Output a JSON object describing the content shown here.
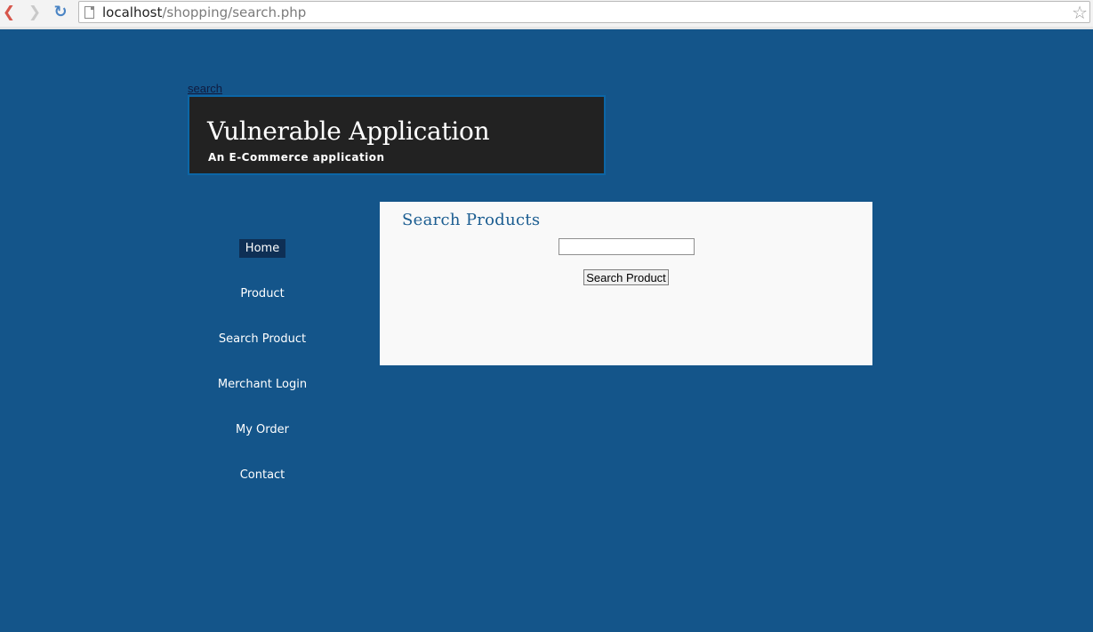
{
  "browser": {
    "back_icon": "back-arrow-icon",
    "forward_icon": "forward-arrow-icon",
    "reload_icon": "reload-icon",
    "url_host": "localhost",
    "url_path": "/shopping/search.php",
    "bookmark_icon": "star-icon"
  },
  "page": {
    "search_link": "search",
    "header": {
      "title": "Vulnerable Application",
      "subtitle": "An E-Commerce application"
    },
    "nav": {
      "items": [
        {
          "label": "Home",
          "active": true
        },
        {
          "label": "Product",
          "active": false
        },
        {
          "label": "Search Product",
          "active": false
        },
        {
          "label": "Merchant Login",
          "active": false
        },
        {
          "label": "My Order",
          "active": false
        },
        {
          "label": "Contact",
          "active": false
        }
      ]
    },
    "search_panel": {
      "title": "Search Products",
      "input_value": "",
      "button_label": "Search Product"
    }
  },
  "colors": {
    "page_background": "#14558a",
    "header_background": "#222222",
    "header_border": "#0c66a6",
    "nav_active_background": "#0e2f55",
    "panel_background": "#f9f9f9",
    "panel_title": "#1b5d91"
  }
}
